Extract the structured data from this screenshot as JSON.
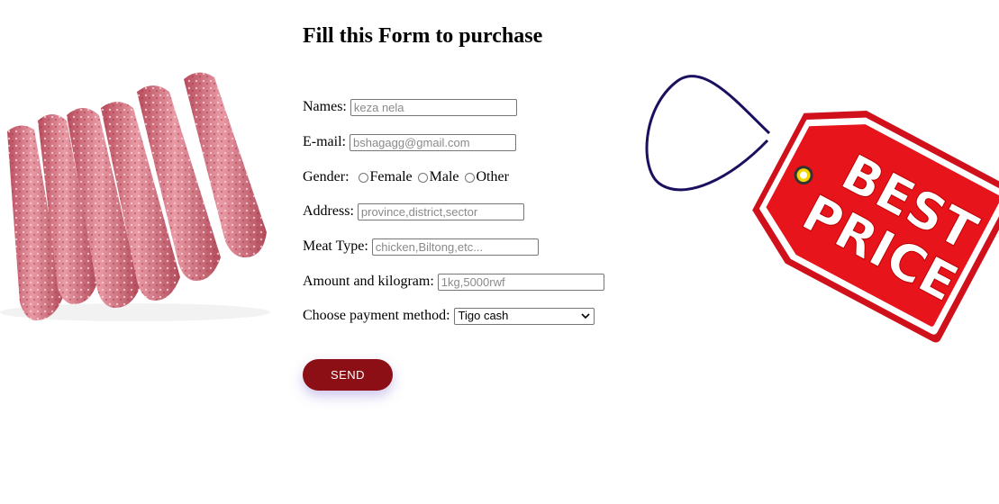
{
  "form": {
    "title": "Fill this Form to purchase",
    "names": {
      "label": "Names:",
      "placeholder": "keza nela"
    },
    "email": {
      "label": "E-mail:",
      "placeholder": "bshagagg@gmail.com"
    },
    "gender": {
      "label": "Gender:",
      "options": [
        "Female",
        "Male",
        "Other"
      ]
    },
    "address": {
      "label": "Address:",
      "placeholder": "province,district,sector"
    },
    "meat_type": {
      "label": "Meat Type:",
      "placeholder": "chicken,Biltong,etc..."
    },
    "amount": {
      "label": "Amount and kilogram:",
      "placeholder": "1kg,5000rwf"
    },
    "payment": {
      "label": "Choose payment method:",
      "selected": "Tigo cash"
    },
    "send_label": "SEND"
  },
  "price_tag": {
    "line1": "BEST",
    "line2": "PRICE"
  },
  "colors": {
    "send_button": "#8b0f14",
    "tag_red": "#e8141c",
    "sausage": "#d4717d"
  },
  "icons": {
    "select_arrow": "chevron-down-icon"
  }
}
